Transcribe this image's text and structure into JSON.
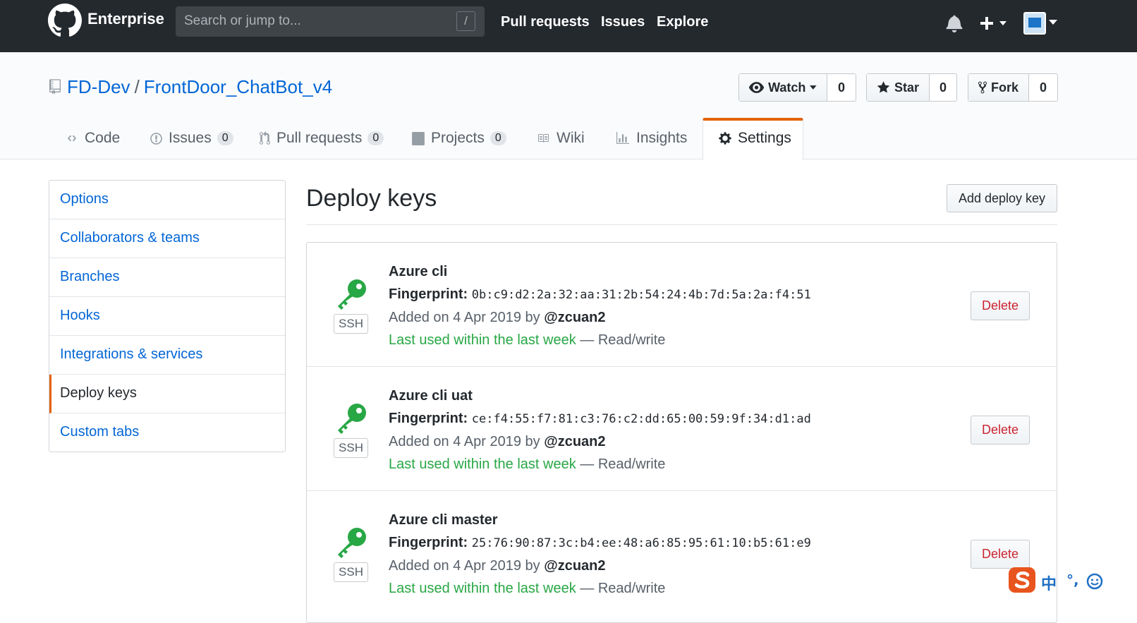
{
  "header": {
    "brand": "Enterprise",
    "search_placeholder": "Search or jump to...",
    "search_shortcut": "/",
    "nav": [
      "Pull requests",
      "Issues",
      "Explore"
    ]
  },
  "repo": {
    "owner": "FD-Dev",
    "separator": "/",
    "name": "FrontDoor_ChatBot_v4",
    "watch_label": "Watch",
    "watch_count": "0",
    "star_label": "Star",
    "star_count": "0",
    "fork_label": "Fork",
    "fork_count": "0"
  },
  "tabs": [
    {
      "label": "Code"
    },
    {
      "label": "Issues",
      "count": "0"
    },
    {
      "label": "Pull requests",
      "count": "0"
    },
    {
      "label": "Projects",
      "count": "0"
    },
    {
      "label": "Wiki"
    },
    {
      "label": "Insights"
    },
    {
      "label": "Settings",
      "selected": true
    }
  ],
  "menu": [
    {
      "label": "Options"
    },
    {
      "label": "Collaborators & teams"
    },
    {
      "label": "Branches"
    },
    {
      "label": "Hooks"
    },
    {
      "label": "Integrations & services"
    },
    {
      "label": "Deploy keys",
      "active": true
    },
    {
      "label": "Custom tabs"
    }
  ],
  "main": {
    "title": "Deploy keys",
    "add_button": "Add deploy key"
  },
  "keys": [
    {
      "name": "Azure cli",
      "fingerprint_label": "Fingerprint:",
      "fingerprint": "0b:c9:d2:2a:32:aa:31:2b:54:24:4b:7d:5a:2a:f4:51",
      "added_prefix": "Added on 4 Apr 2019 by",
      "user": "@zcuan2",
      "last_used": "Last used within the last week",
      "permission": "— Read/write",
      "type": "SSH",
      "delete_label": "Delete"
    },
    {
      "name": "Azure cli uat",
      "fingerprint_label": "Fingerprint:",
      "fingerprint": "ce:f4:55:f7:81:c3:76:c2:dd:65:00:59:9f:34:d1:ad",
      "added_prefix": "Added on 4 Apr 2019 by",
      "user": "@zcuan2",
      "last_used": "Last used within the last week",
      "permission": "— Read/write",
      "type": "SSH",
      "delete_label": "Delete"
    },
    {
      "name": "Azure cli master",
      "fingerprint_label": "Fingerprint:",
      "fingerprint": "25:76:90:87:3c:b4:ee:48:a6:85:95:61:10:b5:61:e9",
      "added_prefix": "Added on 4 Apr 2019 by",
      "user": "@zcuan2",
      "last_used": "Last used within the last week",
      "permission": "— Read/write",
      "type": "SSH",
      "delete_label": "Delete"
    }
  ],
  "ime": {
    "lang": "中",
    "punct": "°,"
  },
  "colors": {
    "header_bg": "#24292e",
    "link": "#0366d6",
    "accent_orange": "#e36209",
    "key_green": "#28a745",
    "delete_red": "#cb2431"
  }
}
